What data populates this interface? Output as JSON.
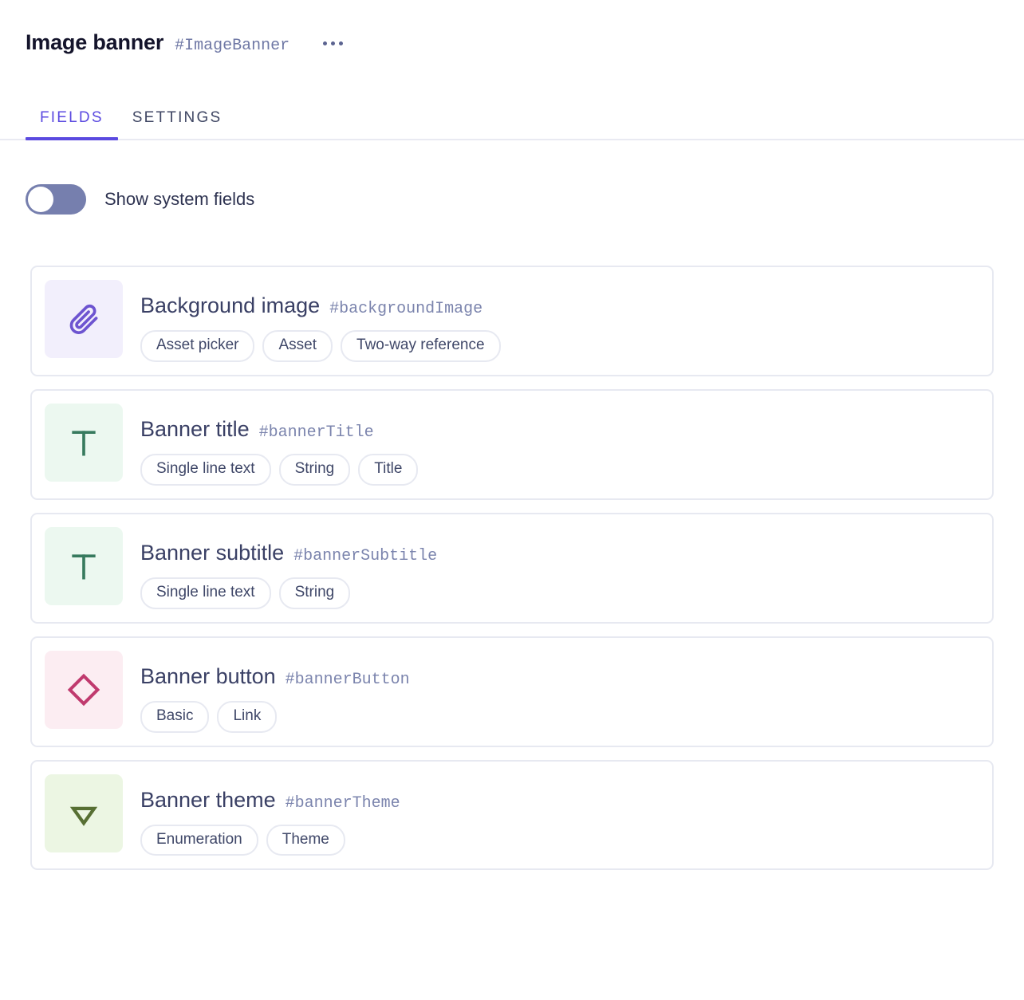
{
  "header": {
    "title": "Image banner",
    "api_id": "#ImageBanner",
    "more_menu_icon": "ellipsis-icon"
  },
  "tabs": [
    {
      "label": "FIELDS",
      "active": true
    },
    {
      "label": "SETTINGS",
      "active": false
    }
  ],
  "system_fields_toggle": {
    "label": "Show system fields",
    "checked": false
  },
  "colors": {
    "accent": "#5b4ae0",
    "toggle_track": "#767fae",
    "card_border": "#e7e9f1",
    "title": "#14142b",
    "api_id": "#7b84ad",
    "tag_text": "#3f4768"
  },
  "fields": [
    {
      "name": "Background image",
      "api_id": "#backgroundImage",
      "icon": "paperclip-icon",
      "icon_bg": "#f2effc",
      "icon_color": "#6d54d0",
      "tags": [
        "Asset picker",
        "Asset",
        "Two-way reference"
      ]
    },
    {
      "name": "Banner title",
      "api_id": "#bannerTitle",
      "icon": "text-t-icon",
      "icon_bg": "#ecf8f0",
      "icon_color": "#377a5e",
      "tags": [
        "Single line text",
        "String",
        "Title"
      ]
    },
    {
      "name": "Banner subtitle",
      "api_id": "#bannerSubtitle",
      "icon": "text-t-icon",
      "icon_bg": "#ecf8f0",
      "icon_color": "#377a5e",
      "tags": [
        "Single line text",
        "String"
      ]
    },
    {
      "name": "Banner button",
      "api_id": "#bannerButton",
      "icon": "diamond-icon",
      "icon_bg": "#fcedf2",
      "icon_color": "#c03a6e",
      "tags": [
        "Basic",
        "Link"
      ]
    },
    {
      "name": "Banner theme",
      "api_id": "#bannerTheme",
      "icon": "triangle-down-icon",
      "icon_bg": "#ecf6e3",
      "icon_color": "#576f33",
      "tags": [
        "Enumeration",
        "Theme"
      ]
    }
  ]
}
